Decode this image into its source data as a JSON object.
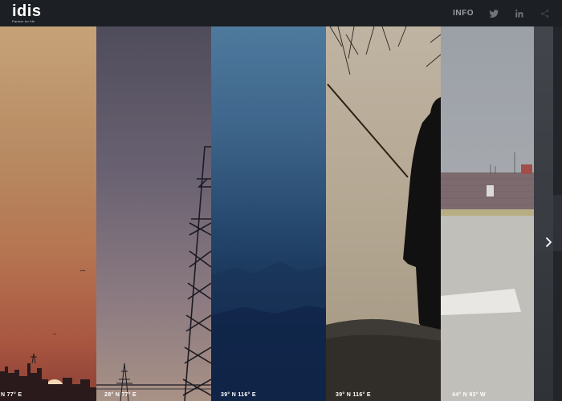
{
  "header": {
    "logo_word": "idis",
    "logo_tagline": "Partner for life",
    "nav_info": "INFO",
    "icons": [
      "twitter-icon",
      "linkedin-icon",
      "share-icon"
    ]
  },
  "gallery": {
    "panels": [
      {
        "coord": "N 77° E"
      },
      {
        "coord": "28° N 77° E"
      },
      {
        "coord": "39° N 116° E"
      },
      {
        "coord": "39° N 116° E"
      },
      {
        "coord": "44° N 93° W"
      },
      {
        "coord": ""
      }
    ],
    "next_icon": "chevron-right-icon"
  },
  "colors": {
    "topbar": "#1c1f23",
    "nav_text": "#9aa0a6"
  }
}
